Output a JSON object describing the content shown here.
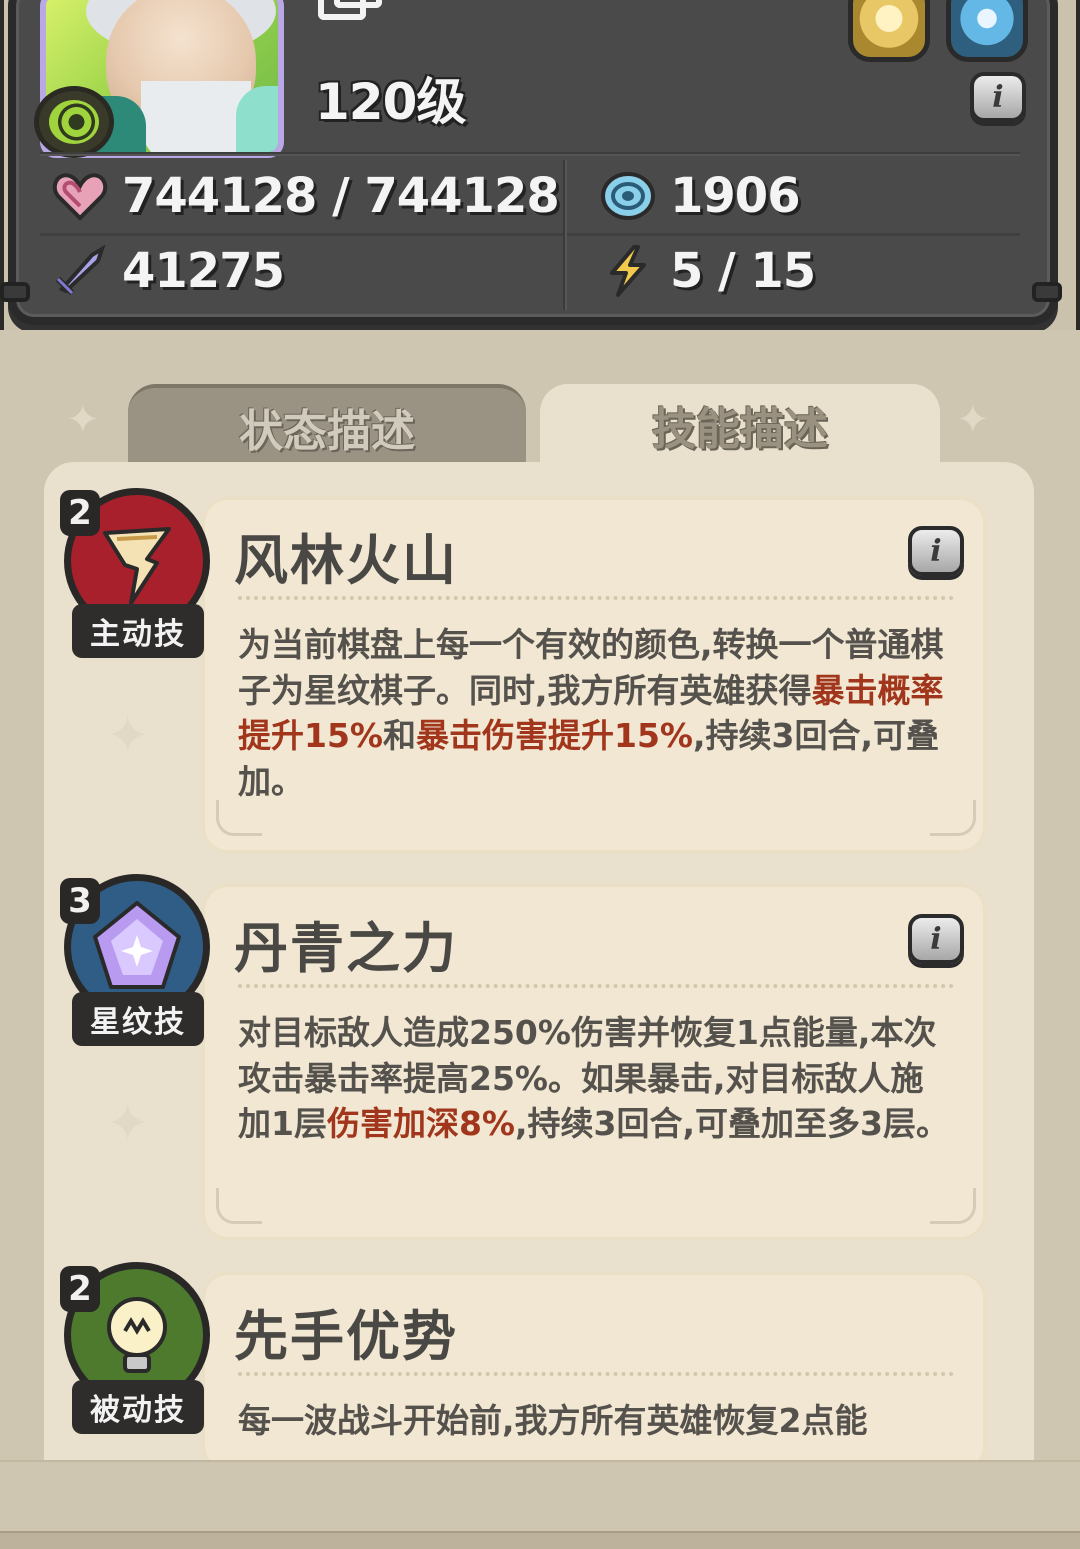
{
  "hero": {
    "level": "120级",
    "hp": "744128 / 744128",
    "defense": "1906",
    "attack": "41275",
    "energy": "5 / 15"
  },
  "tabs": [
    {
      "label": "状态描述",
      "active": false
    },
    {
      "label": "技能描述",
      "active": true
    }
  ],
  "skills": [
    {
      "level": "2",
      "type": "主动技",
      "name": "风林火山",
      "desc_parts": [
        {
          "text": "为当前棋盘上每一个有效的颜色,转换一个普通棋子为星纹棋子。同时,我方所有英雄获得",
          "hl": false
        },
        {
          "text": "暴击概率提升15%",
          "hl": true
        },
        {
          "text": "和",
          "hl": false
        },
        {
          "text": "暴击伤害提升15%",
          "hl": true
        },
        {
          "text": ",持续3回合,可叠加。",
          "hl": false
        }
      ]
    },
    {
      "level": "3",
      "type": "星纹技",
      "name": "丹青之力",
      "desc_parts": [
        {
          "text": "对目标敌人造成250%伤害并恢复1点能量,本次攻击暴击率提高25%。如果暴击,对目标敌人施加1层",
          "hl": false
        },
        {
          "text": "伤害加深8%",
          "hl": true
        },
        {
          "text": ",持续3回合,可叠加至多3层。",
          "hl": false
        }
      ]
    },
    {
      "level": "2",
      "type": "被动技",
      "name": "先手优势",
      "desc_parts": [
        {
          "text": "每一波战斗开始前,我方所有英雄恢复2点能",
          "hl": false
        }
      ]
    }
  ],
  "colors": {
    "highlight": "#a1361c",
    "active_icon": "#a8202c",
    "star_icon": "#2f5d85",
    "passive_icon": "#4d7a2c"
  }
}
